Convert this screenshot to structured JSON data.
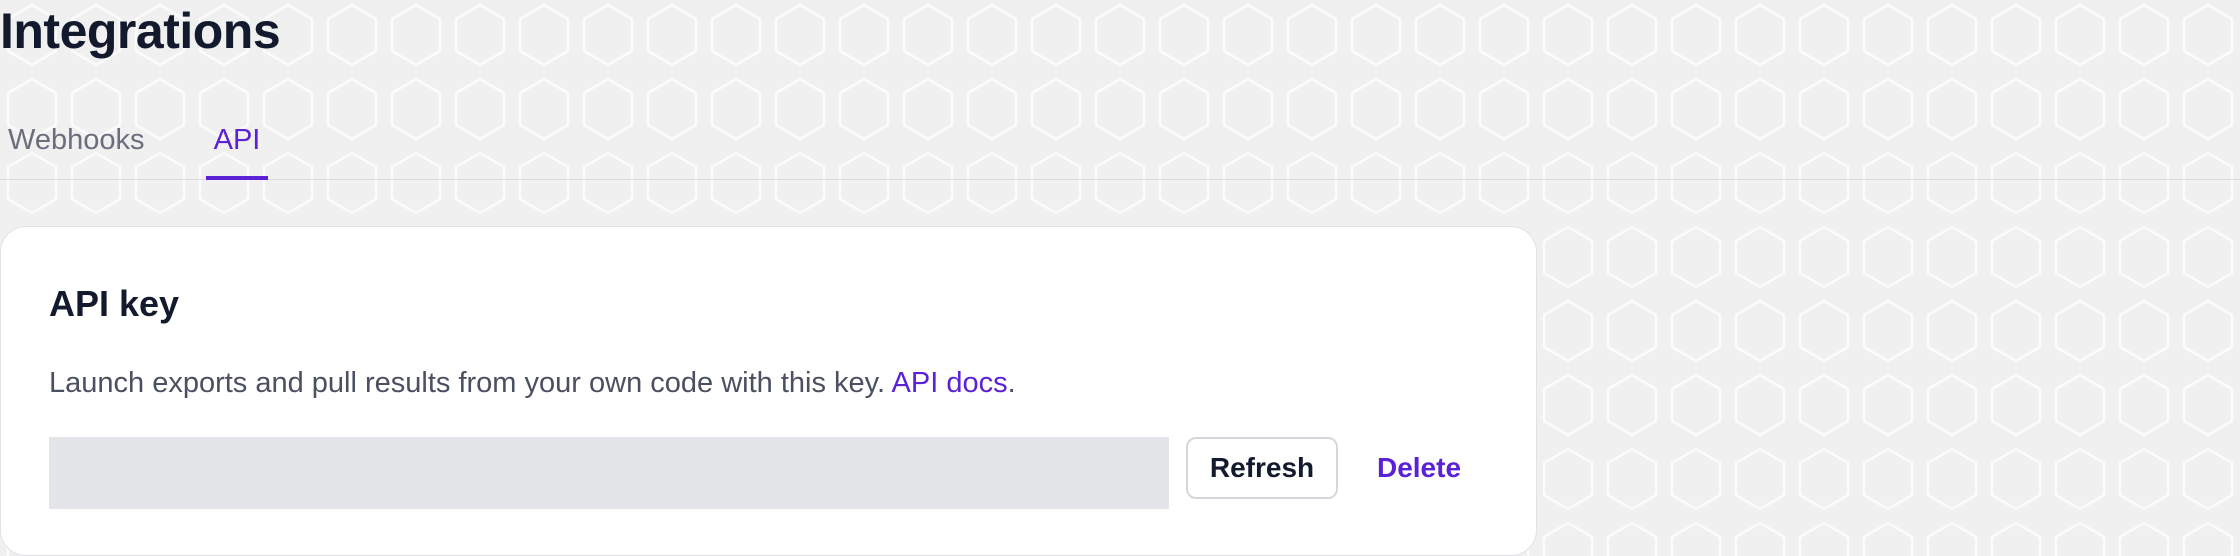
{
  "page": {
    "title": "Integrations"
  },
  "tabs": [
    {
      "label": "Webhooks",
      "active": false
    },
    {
      "label": "API",
      "active": true
    }
  ],
  "api_card": {
    "title": "API key",
    "description": "Launch exports and pull results from your own code with this key.",
    "docs_link": "API docs",
    "description_end": ".",
    "key_value": "",
    "refresh_label": "Refresh",
    "delete_label": "Delete"
  },
  "colors": {
    "accent": "#5b21d6",
    "background": "#f0f0f0",
    "card": "#ffffff",
    "text_dark": "#141a2e",
    "text_muted": "#6b6e7d",
    "field_bg": "#e4e5e9"
  }
}
